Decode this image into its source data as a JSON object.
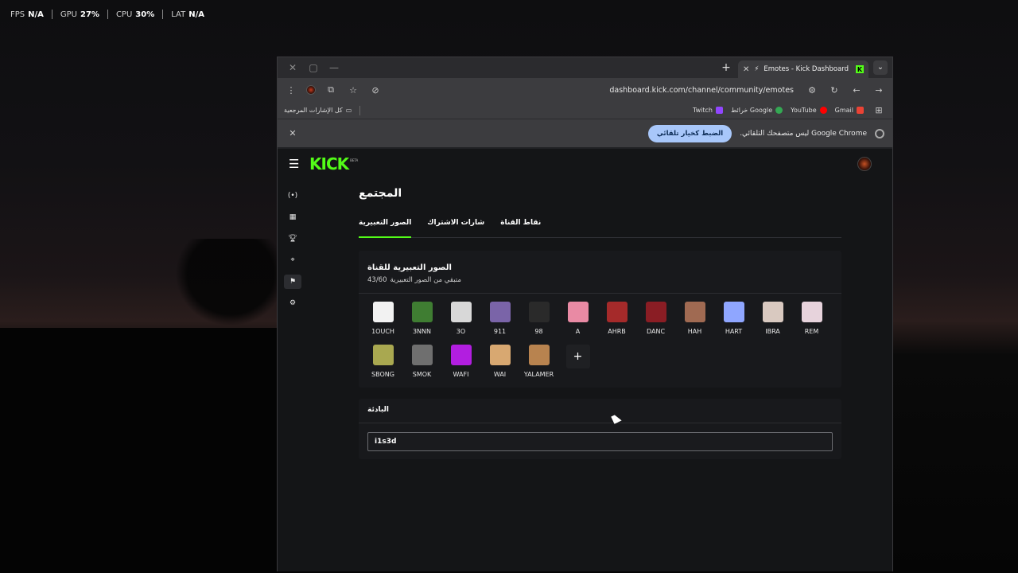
{
  "overlay": {
    "fps_label": "FPS",
    "fps_value": "N/A",
    "gpu_label": "GPU",
    "gpu_value": "27%",
    "cpu_label": "CPU",
    "cpu_value": "30%",
    "lat_label": "LAT",
    "lat_value": "N/A"
  },
  "browser": {
    "tab_title": "Emotes - Kick Dashboard",
    "url": "dashboard.kick.com/channel/community/emotes",
    "bookmarks": {
      "all_bookmarks": "كل الإشارات المرجعية",
      "twitch": "Twitch",
      "maps": "خرائط Google",
      "youtube": "YouTube",
      "gmail": "Gmail"
    },
    "infobar": {
      "message": "Google Chrome ليس متصفحك التلقائي.",
      "button": "الضبط كخيار تلقائي"
    }
  },
  "kick": {
    "logo": "KICK",
    "beta": "BETA",
    "page_title": "المجتمع",
    "tabs": [
      "الصور التعبيرية",
      "شارات الاشتراك",
      "نقاط القناة"
    ],
    "emotes_card": {
      "title": "الصور التعبيرية للقناة",
      "remaining_label": "متبقي من الصور التعبيرية",
      "remaining_count": "43/60"
    },
    "emotes": [
      {
        "name": "1OUCH",
        "color": "#f2f2f2"
      },
      {
        "name": "3NNN",
        "color": "#3f7d32"
      },
      {
        "name": "3O",
        "color": "#d8d8d8"
      },
      {
        "name": "911",
        "color": "#7a64a8"
      },
      {
        "name": "98",
        "color": "#2a2a2a"
      },
      {
        "name": "A",
        "color": "#e98aa4"
      },
      {
        "name": "AHRB",
        "color": "#a52a2a"
      },
      {
        "name": "DANC",
        "color": "#8a1d24"
      },
      {
        "name": "HAH",
        "color": "#a06a52"
      },
      {
        "name": "HART",
        "color": "#8fa6ff"
      },
      {
        "name": "IBRA",
        "color": "#d9c9c0"
      },
      {
        "name": "REM",
        "color": "#e7d3dc"
      },
      {
        "name": "SBONG",
        "color": "#a9a850"
      },
      {
        "name": "SMOK",
        "color": "#6f6f6f"
      },
      {
        "name": "WAFI",
        "color": "#b21ee0"
      },
      {
        "name": "WAI",
        "color": "#d8a871"
      },
      {
        "name": "YALAMER",
        "color": "#b8834f"
      }
    ],
    "prefix_card": {
      "title": "البادئة",
      "value": "i1s3d"
    }
  },
  "colors": {
    "kick_green": "#53fc18",
    "infobar_button": "#a8c7fa"
  }
}
